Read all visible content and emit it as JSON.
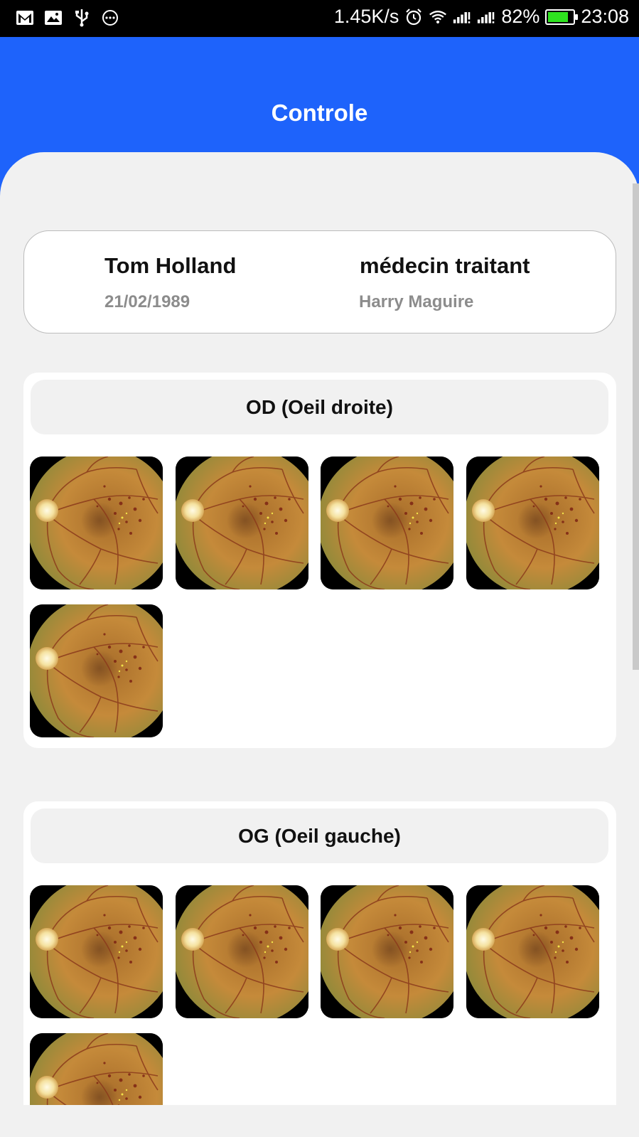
{
  "status_bar": {
    "left_icons": [
      "gmail-icon",
      "image-icon",
      "usb-icon",
      "more-icon"
    ],
    "net_speed": "1.45K/s",
    "battery_percent": "82%",
    "battery_level": 0.82,
    "time": "23:08"
  },
  "header": {
    "title": "Controle"
  },
  "patient": {
    "name": "Tom Holland",
    "dob": "21/02/1989",
    "doctor_label": "médecin traitant",
    "doctor_name": "Harry Maguire"
  },
  "sections": {
    "od": {
      "title": "OD (Oeil droite)",
      "image_count": 5
    },
    "og": {
      "title": "OG (Oeil gauche)",
      "image_count": 5
    }
  },
  "colors": {
    "header_blue": "#1e63fb",
    "background": "#f1f1f1",
    "battery_green": "#2ee21f"
  }
}
